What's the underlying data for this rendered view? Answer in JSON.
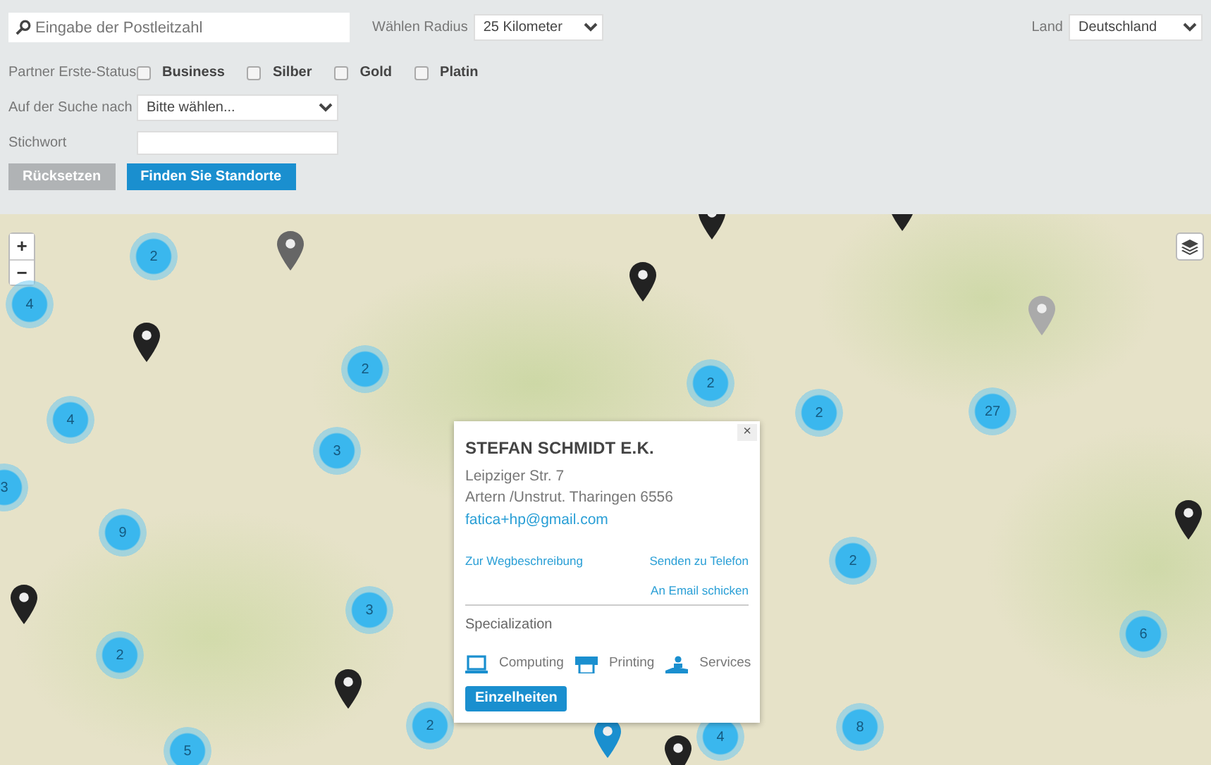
{
  "search": {
    "placeholder": "Eingabe der Postleitzahl"
  },
  "radius": {
    "label": "Wählen Radius",
    "value": "25 Kilometer"
  },
  "country": {
    "label": "Land",
    "value": "Deutschland"
  },
  "partner_status": {
    "label": "Partner Erste-Status",
    "options": [
      {
        "label": "Business",
        "checked": false
      },
      {
        "label": "Silber",
        "checked": false
      },
      {
        "label": "Gold",
        "checked": false
      },
      {
        "label": "Platin",
        "checked": false
      }
    ]
  },
  "looking_for": {
    "label": "Auf der Suche nach",
    "value": "Bitte wählen..."
  },
  "keyword": {
    "label": "Stichwort"
  },
  "buttons": [
    {
      "label": "Rücksetzen",
      "kind": "secondary"
    },
    {
      "label": "Finden Sie Standorte",
      "kind": "primary"
    }
  ],
  "map": {
    "zoom_controls": [
      "+",
      "−"
    ],
    "clusters": [
      {
        "count": "2"
      },
      {
        "count": "4"
      },
      {
        "count": "2"
      },
      {
        "count": "4"
      },
      {
        "count": "3"
      },
      {
        "count": "3"
      },
      {
        "count": "9"
      },
      {
        "count": "2"
      },
      {
        "count": "3"
      },
      {
        "count": "2"
      },
      {
        "count": "5"
      },
      {
        "count": "2"
      },
      {
        "count": "2"
      },
      {
        "count": "27"
      },
      {
        "count": "2"
      },
      {
        "count": "6"
      },
      {
        "count": "8"
      },
      {
        "count": "4"
      }
    ],
    "markers": [
      {
        "color": "#666666"
      },
      {
        "color": "#222222"
      },
      {
        "color": "#222222"
      },
      {
        "color": "#222222"
      },
      {
        "color": "#222222"
      },
      {
        "color": "#aaaaaa"
      },
      {
        "color": "#222222"
      },
      {
        "color": "#222222"
      },
      {
        "color": "#222222"
      },
      {
        "color": "#1a8fcf"
      },
      {
        "color": "#222222"
      }
    ],
    "popup": {
      "close": "×",
      "name": "STEFAN SCHMIDT E.K.",
      "street": "Leipziger Str. 7",
      "city": "Artern /Unstrut. Tharingen 6556",
      "email": "fatica+hp@gmail.com",
      "links": [
        "Zur Wegbeschreibung",
        "Senden zu Telefon",
        "An Email schicken"
      ],
      "specialization_title": "Specialization",
      "specializations": [
        {
          "kind": "computing",
          "label": "Computing"
        },
        {
          "kind": "printing",
          "label": "Printing"
        },
        {
          "kind": "services",
          "label": "Services"
        }
      ],
      "details_button": "Einzelheiten"
    }
  }
}
